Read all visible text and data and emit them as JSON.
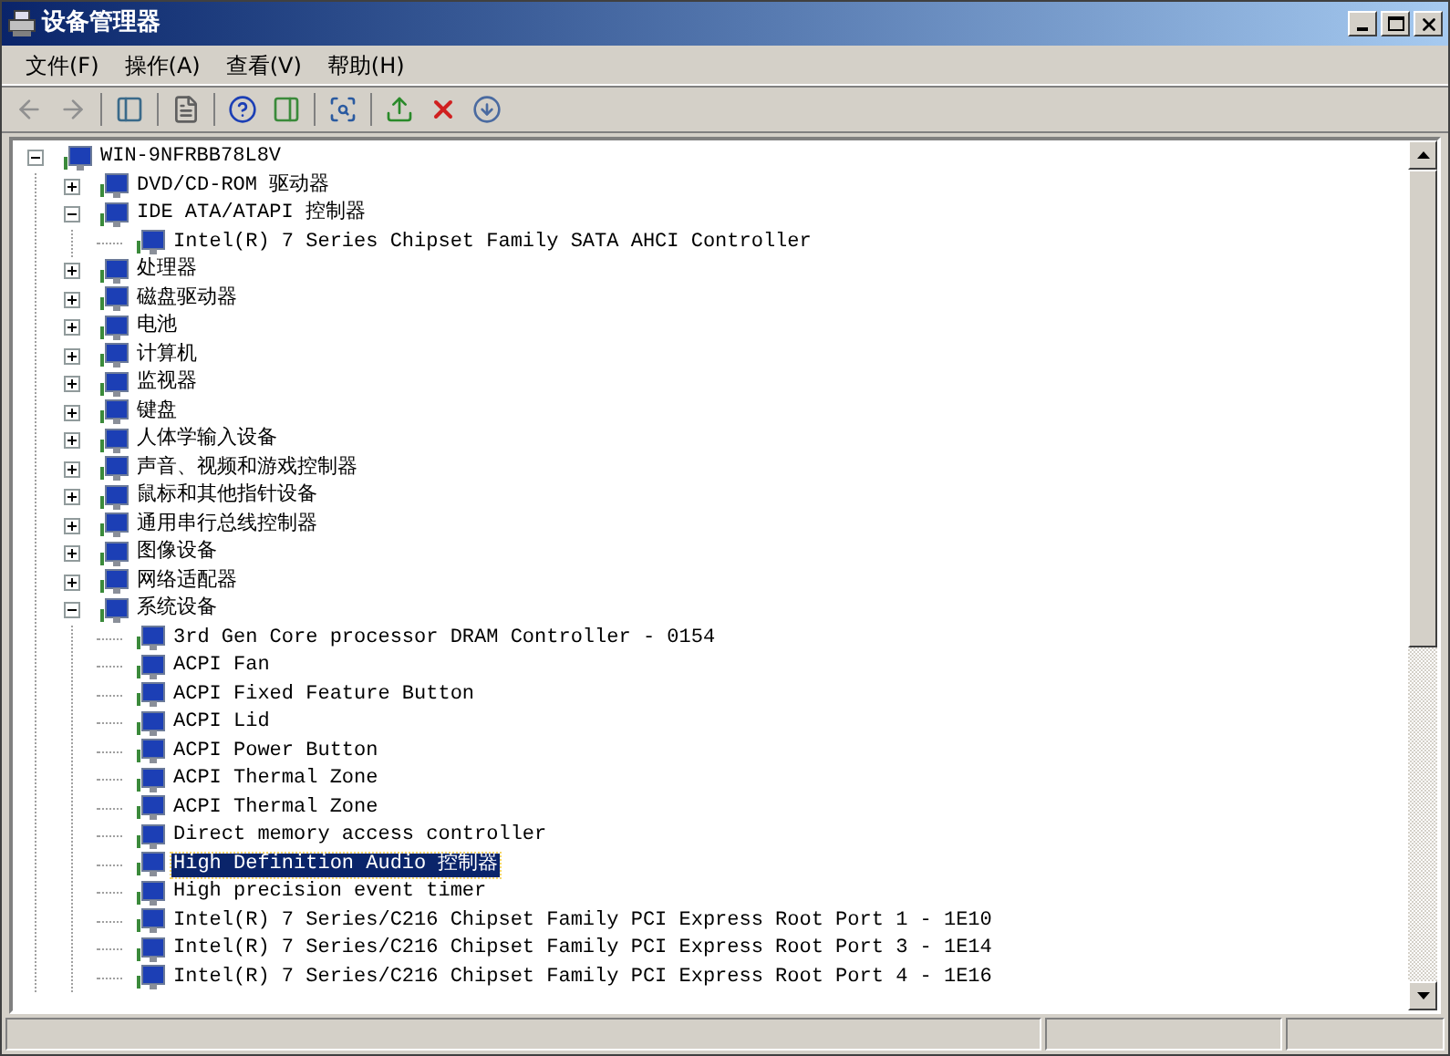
{
  "window": {
    "title": "设备管理器"
  },
  "menu": [
    "文件(F)",
    "操作(A)",
    "查看(V)",
    "帮助(H)"
  ],
  "tree": {
    "label": "WIN-9NFRBB78L8V",
    "expanded": true,
    "selected": false,
    "children": [
      {
        "label": "DVD/CD-ROM 驱动器",
        "expanded": false,
        "selected": false
      },
      {
        "label": "IDE ATA/ATAPI 控制器",
        "expanded": true,
        "selected": false,
        "children": [
          {
            "label": "Intel(R) 7 Series Chipset Family SATA AHCI Controller",
            "selected": false
          }
        ]
      },
      {
        "label": "处理器",
        "expanded": false,
        "selected": false
      },
      {
        "label": "磁盘驱动器",
        "expanded": false,
        "selected": false
      },
      {
        "label": "电池",
        "expanded": false,
        "selected": false
      },
      {
        "label": "计算机",
        "expanded": false,
        "selected": false
      },
      {
        "label": "监视器",
        "expanded": false,
        "selected": false
      },
      {
        "label": "键盘",
        "expanded": false,
        "selected": false
      },
      {
        "label": "人体学输入设备",
        "expanded": false,
        "selected": false
      },
      {
        "label": "声音、视频和游戏控制器",
        "expanded": false,
        "selected": false
      },
      {
        "label": "鼠标和其他指针设备",
        "expanded": false,
        "selected": false
      },
      {
        "label": "通用串行总线控制器",
        "expanded": false,
        "selected": false
      },
      {
        "label": "图像设备",
        "expanded": false,
        "selected": false
      },
      {
        "label": "网络适配器",
        "expanded": false,
        "selected": false
      },
      {
        "label": "系统设备",
        "expanded": true,
        "selected": false,
        "children": [
          {
            "label": "3rd Gen Core processor DRAM Controller - 0154",
            "selected": false
          },
          {
            "label": "ACPI Fan",
            "selected": false
          },
          {
            "label": "ACPI Fixed Feature Button",
            "selected": false
          },
          {
            "label": "ACPI Lid",
            "selected": false
          },
          {
            "label": "ACPI Power Button",
            "selected": false
          },
          {
            "label": "ACPI Thermal Zone",
            "selected": false
          },
          {
            "label": "ACPI Thermal Zone",
            "selected": false
          },
          {
            "label": "Direct memory access controller",
            "selected": false
          },
          {
            "label": "High Definition Audio 控制器",
            "selected": true
          },
          {
            "label": "High precision event timer",
            "selected": false
          },
          {
            "label": "Intel(R) 7 Series/C216 Chipset Family PCI Express Root Port 1 - 1E10",
            "selected": false
          },
          {
            "label": "Intel(R) 7 Series/C216 Chipset Family PCI Express Root Port 3 - 1E14",
            "selected": false
          },
          {
            "label": "Intel(R) 7 Series/C216 Chipset Family PCI Express Root Port 4 - 1E16",
            "selected": false
          }
        ]
      }
    ]
  }
}
